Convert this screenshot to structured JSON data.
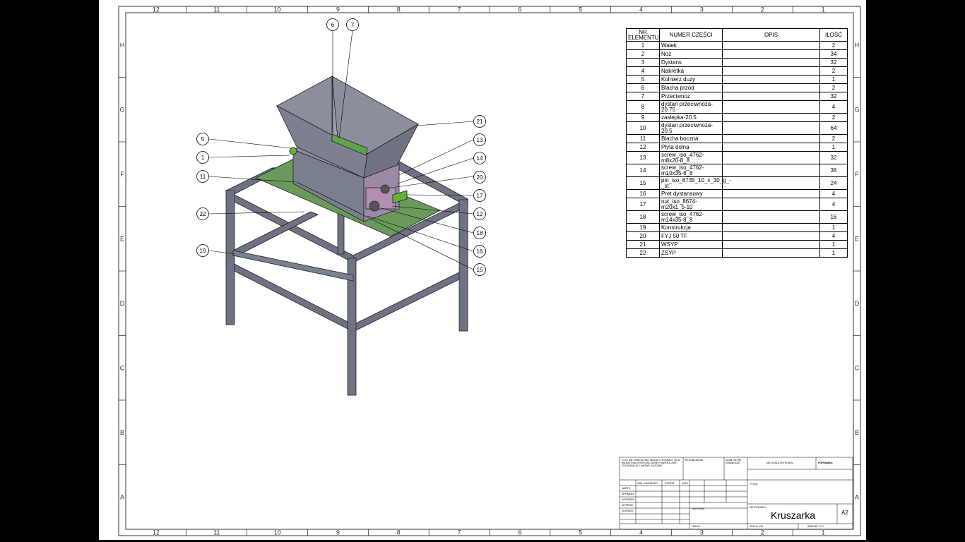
{
  "sheet": {
    "columns": [
      "12",
      "11",
      "10",
      "9",
      "8",
      "7",
      "6",
      "5",
      "4",
      "3",
      "2",
      "1"
    ],
    "rows": [
      "H",
      "G",
      "F",
      "E",
      "D",
      "C",
      "B",
      "A"
    ]
  },
  "balloons": [
    "6",
    "7",
    "21",
    "13",
    "14",
    "20",
    "17",
    "12",
    "18",
    "16",
    "15",
    "5",
    "1",
    "11",
    "22",
    "19"
  ],
  "bom": {
    "headers": [
      "NR ELEMENTU",
      "NUMER CZĘŚCI",
      "OPIS",
      "ILOŚĆ"
    ],
    "rows": [
      {
        "nr": "1",
        "name": "Wałek",
        "opis": "",
        "qty": "2"
      },
      {
        "nr": "2",
        "name": "Noz",
        "opis": "",
        "qty": "34"
      },
      {
        "nr": "3",
        "name": "Dystans",
        "opis": "",
        "qty": "32"
      },
      {
        "nr": "4",
        "name": "Nakretka",
        "opis": "",
        "qty": "2"
      },
      {
        "nr": "5",
        "name": "Kolnierz duzy",
        "opis": "",
        "qty": "1"
      },
      {
        "nr": "6",
        "name": "Blacha przód",
        "opis": "",
        "qty": "2"
      },
      {
        "nr": "7",
        "name": "Przeciwnoz",
        "opis": "",
        "qty": "32"
      },
      {
        "nr": "8",
        "name": "dystan przeciwnoza-20.75",
        "opis": "",
        "qty": "4"
      },
      {
        "nr": "9",
        "name": "zaslepka-20.5",
        "opis": "",
        "qty": "2"
      },
      {
        "nr": "10",
        "name": "dystan przeciwnoza-20.5",
        "opis": "",
        "qty": "64"
      },
      {
        "nr": "11",
        "name": "Blacha boczna",
        "opis": "",
        "qty": "2"
      },
      {
        "nr": "12",
        "name": "Płyta dolna",
        "opis": "",
        "qty": "1"
      },
      {
        "nr": "13",
        "name": "screw_iso_4762-m8x20-8_8",
        "opis": "",
        "qty": "32"
      },
      {
        "nr": "14",
        "name": "screw_iso_4762-m10x35-8_8",
        "opis": "",
        "qty": "36"
      },
      {
        "nr": "15",
        "name": "pin_iso_8735_10_x_30_g_-_st",
        "opis": "",
        "qty": "24"
      },
      {
        "nr": "16",
        "name": "Pret dystansowy",
        "opis": "",
        "qty": "4"
      },
      {
        "nr": "17",
        "name": "nut_iso_8674-m20x1_5-10",
        "opis": "",
        "qty": "4"
      },
      {
        "nr": "18",
        "name": "screw_iso_4762-m14x35-8_8",
        "opis": "",
        "qty": "16"
      },
      {
        "nr": "19",
        "name": "Konstrukcja",
        "opis": "",
        "qty": "1"
      },
      {
        "nr": "20",
        "name": "FYJ 50 TF",
        "opis": "",
        "qty": "4"
      },
      {
        "nr": "21",
        "name": "WSYP",
        "opis": "",
        "qty": "1"
      },
      {
        "nr": "22",
        "name": "ZSYP",
        "opis": "",
        "qty": "1"
      }
    ]
  },
  "title_block": {
    "note": "O ILE NIE OKREŚLONO INACZEJ: WYMIARY SĄ W MILIMETRACH WYKOŃCZENIE POWIERZCHNI: TOLERANCJE: LINIOWE: KĄTOWE:",
    "finish": "WYKOŃCZENIE:",
    "edge": "ZŁAM OSTRE KRAWĘDZIE",
    "no_scale": "NIE SKALUJ RYSUNKU",
    "revision": "POPRAWKA",
    "cols": [
      "IMIĘ I NAZWISKO",
      "PODPIS",
      "DATA"
    ],
    "roles": [
      "NARYS.",
      "SPRAWDZ.",
      "ZATWIERD.",
      "WYPROD.",
      "ZLAPADO"
    ],
    "title_label": "TYTUŁ:",
    "material": "MATERIAŁ:",
    "weight": "WAGA:",
    "drawing_no_label": "NR RYSUNKU",
    "scale": "SKALA:1:20",
    "sheet": "ARKUSZ 1 Z 1",
    "title": "Kruszarka",
    "size": "A2"
  }
}
